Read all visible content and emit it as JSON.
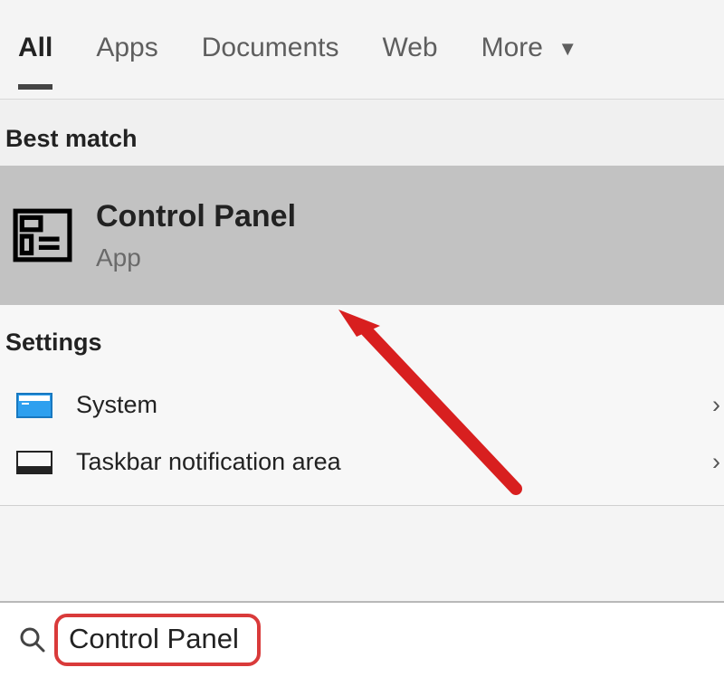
{
  "tabs": {
    "all": "All",
    "apps": "Apps",
    "documents": "Documents",
    "web": "Web",
    "more": "More"
  },
  "sections": {
    "best_match": "Best match",
    "settings": "Settings"
  },
  "best_match_item": {
    "title": "Control Panel",
    "subtitle": "App"
  },
  "settings_items": {
    "system": "System",
    "taskbar": "Taskbar notification area"
  },
  "search": {
    "query": "Control Panel"
  }
}
